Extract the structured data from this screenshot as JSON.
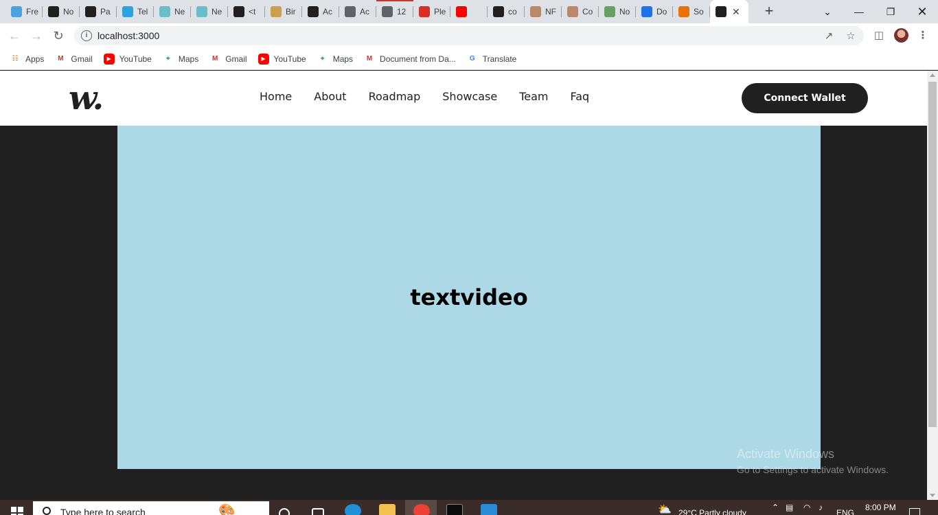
{
  "browser": {
    "tabs": [
      {
        "title": "Fre",
        "icon": "bird-icon",
        "color": "#4aa3df"
      },
      {
        "title": "No",
        "icon": "notion-icon",
        "color": "#202020"
      },
      {
        "title": "Pa",
        "icon": "github-icon",
        "color": "#202020"
      },
      {
        "title": "Tel",
        "icon": "telegram-icon",
        "color": "#2aa3df"
      },
      {
        "title": "Ne",
        "icon": "globe-icon",
        "color": "#6bbec7"
      },
      {
        "title": "Ne",
        "icon": "globe-icon",
        "color": "#6bbec7"
      },
      {
        "title": "<t",
        "icon": "medium-icon",
        "color": "#202020"
      },
      {
        "title": "Bir",
        "icon": "bird-icon",
        "color": "#caa14a"
      },
      {
        "title": "Ac",
        "icon": "github-icon",
        "color": "#202020"
      },
      {
        "title": "Ac",
        "icon": "globe-icon",
        "color": "#5f6368"
      },
      {
        "title": "12",
        "icon": "globe-icon",
        "color": "#5f6368"
      },
      {
        "title": "Ple",
        "icon": "gmail-icon",
        "color": "#d93025"
      },
      {
        "title": "",
        "icon": "youtube-icon",
        "color": "#ff0000"
      },
      {
        "title": "co",
        "icon": "github-icon",
        "color": "#202020"
      },
      {
        "title": "NF",
        "icon": "avatar-icon",
        "color": "#b88a6a"
      },
      {
        "title": "Co",
        "icon": "avatar-icon",
        "color": "#b88a6a"
      },
      {
        "title": "No",
        "icon": "cube-icon",
        "color": "#68a063"
      },
      {
        "title": "Do",
        "icon": "download-icon",
        "color": "#1a73e8"
      },
      {
        "title": "So",
        "icon": "puzzle-icon",
        "color": "#e8710a"
      },
      {
        "title": "",
        "icon": "react-icon",
        "color": "#202020"
      }
    ],
    "address": "localhost:3000",
    "bookmarks": [
      {
        "label": "Apps",
        "icon": "apps-icon",
        "color": "#e8710a"
      },
      {
        "label": "Gmail",
        "icon": "gmail-icon",
        "color": "#d93025"
      },
      {
        "label": "YouTube",
        "icon": "youtube-icon",
        "color": "#ff0000"
      },
      {
        "label": "Maps",
        "icon": "maps-icon",
        "color": "#34a853"
      },
      {
        "label": "Gmail",
        "icon": "gmail-icon",
        "color": "#d93025"
      },
      {
        "label": "YouTube",
        "icon": "youtube-icon",
        "color": "#ff0000"
      },
      {
        "label": "Maps",
        "icon": "maps-icon",
        "color": "#34a853"
      },
      {
        "label": "Document from Da...",
        "icon": "gmail-icon",
        "color": "#d93025"
      },
      {
        "label": "Translate",
        "icon": "translate-icon",
        "color": "#4285f4"
      }
    ]
  },
  "site": {
    "logo": "w.",
    "nav": [
      "Home",
      "About",
      "Roadmap",
      "Showcase",
      "Team",
      "Faq"
    ],
    "cta": "Connect Wallet",
    "hero_text": "textvideo",
    "colors": {
      "hero_bg": "#add8e6",
      "page_bg": "#202020",
      "header_bg": "#ffffff"
    }
  },
  "watermark": {
    "title": "Activate Windows",
    "subtitle": "Go to Settings to activate Windows."
  },
  "taskbar": {
    "search_placeholder": "Type here to search",
    "weather": "29°C  Partly cloudy",
    "language": "ENG",
    "time": "8:00 PM"
  }
}
